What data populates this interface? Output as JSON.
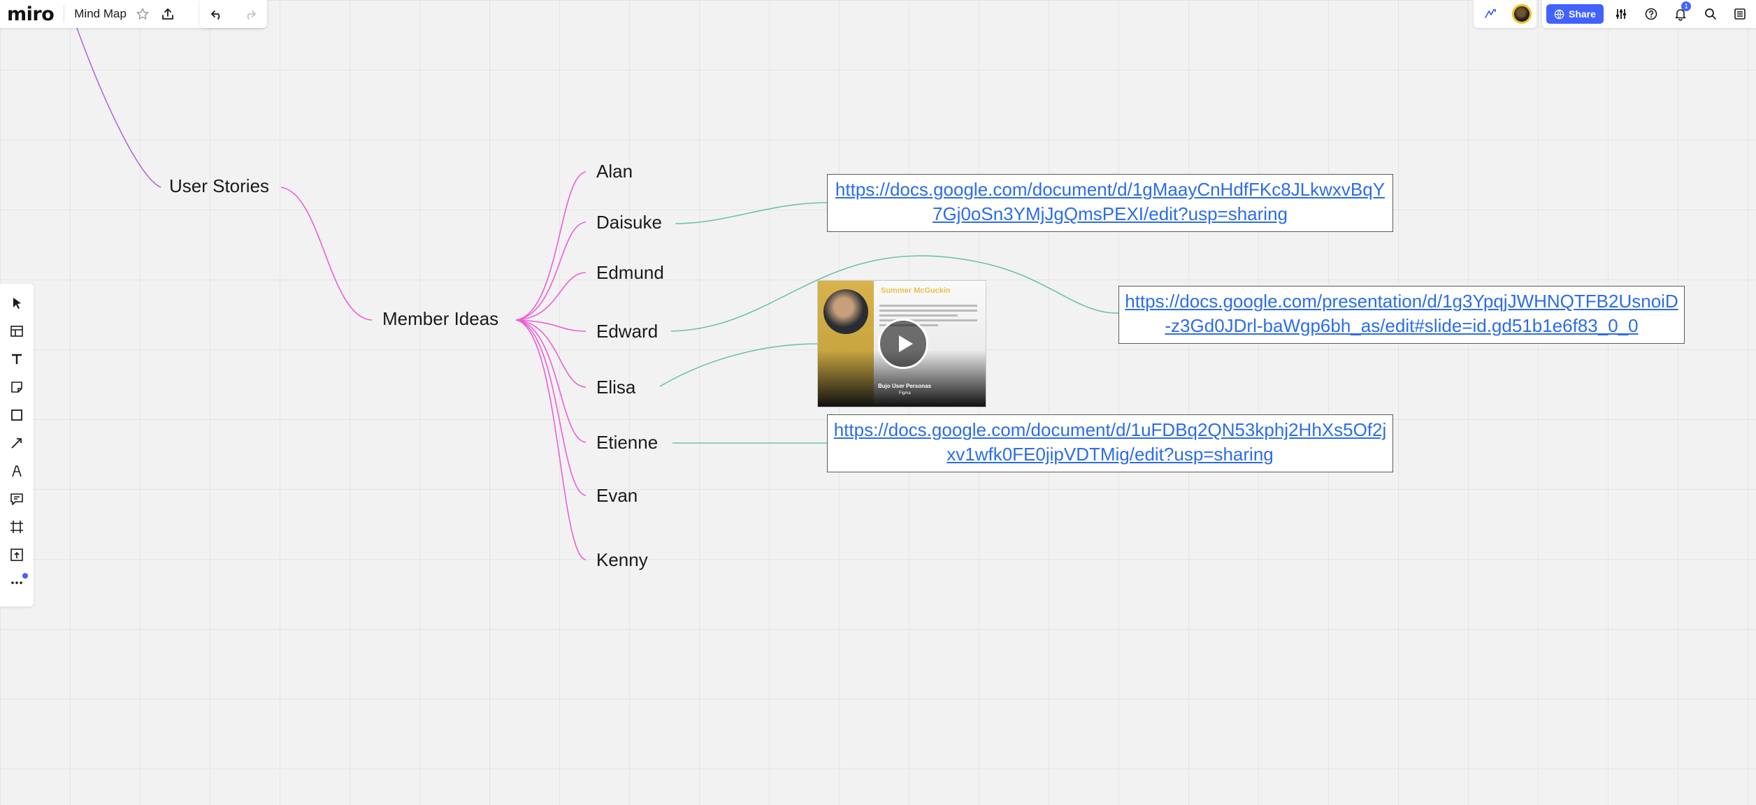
{
  "app": {
    "logo": "miro",
    "board_title": "Mind Map"
  },
  "header": {
    "share_label": "Share",
    "notification_count": "1"
  },
  "toolbar": {
    "tools": [
      "select-cursor-icon",
      "templates-icon",
      "text-icon",
      "sticky-note-icon",
      "shape-icon",
      "connection-line-icon",
      "pen-icon",
      "comment-icon",
      "frame-icon",
      "upload-icon",
      "more-icon"
    ]
  },
  "mindmap": {
    "root_branch": "User Stories",
    "sub_branch": "Member Ideas",
    "members": [
      "Alan",
      "Daisuke",
      "Edmund",
      "Edward",
      "Elisa",
      "Etienne",
      "Evan",
      "Kenny"
    ]
  },
  "links": {
    "daisuke_doc": "https://docs.google.com/document/d/1gMaayCnHdfFKc8JLkwxvBqY7Gj0oSn3YMjJgQmsPEXI/edit?usp=sharing",
    "edward_slides": "https://docs.google.com/presentation/d/1g3YpqjJWHNQTFB2UsnoiD-z3Gd0JDrl-baWgp6bh_as/edit#slide=id.gd51b1e6f83_0_0",
    "etienne_doc": "https://docs.google.com/document/d/1uFDBq2QN53kphj2HhXs5Of2jxv1wfk0FE0jipVDTMig/edit?usp=sharing"
  },
  "video_card": {
    "persona_name": "Summer McGuckin",
    "footer_title": "Bujo User Personas",
    "footer_sub": "Figma"
  },
  "colors": {
    "branch_pink": "#ec5fd6",
    "branch_purple": "#b06ae0",
    "link_green": "#6cc4a4",
    "accent_blue": "#4262ff",
    "link_text": "#2b6de8"
  }
}
